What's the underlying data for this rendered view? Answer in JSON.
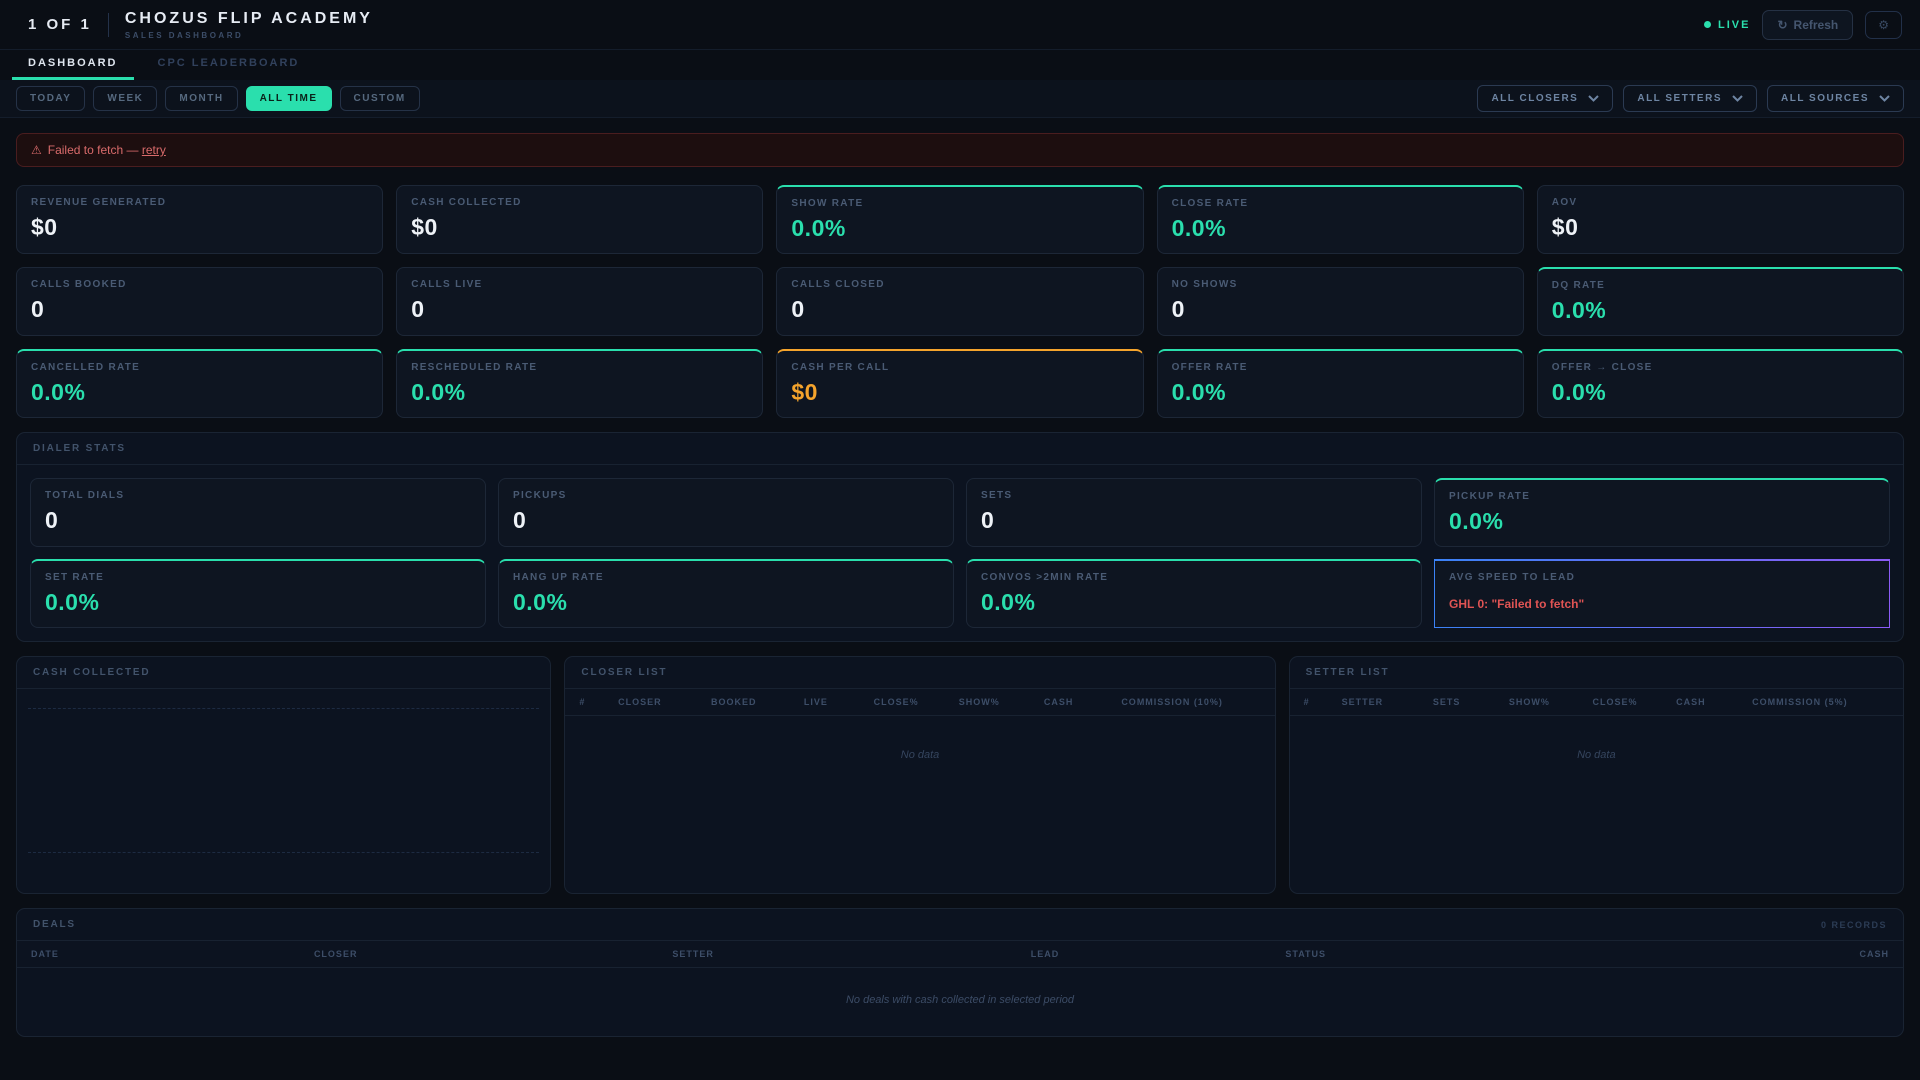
{
  "header": {
    "counter": "1 OF 1",
    "title": "CHOZUS FLIP ACADEMY",
    "subtitle": "SALES DASHBOARD",
    "live_label": "LIVE",
    "refresh_label": "Refresh"
  },
  "icons": {
    "refresh": "↻",
    "gear": "⚙",
    "warning": "⚠",
    "chevron": "▾"
  },
  "tabs": [
    {
      "label": "DASHBOARD",
      "active": true
    },
    {
      "label": "CPC LEADERBOARD",
      "active": false
    }
  ],
  "filters": {
    "ranges": [
      {
        "label": "TODAY",
        "active": false
      },
      {
        "label": "WEEK",
        "active": false
      },
      {
        "label": "MONTH",
        "active": false
      },
      {
        "label": "ALL TIME",
        "active": true
      },
      {
        "label": "CUSTOM",
        "active": false
      }
    ],
    "dropdowns": [
      {
        "label": "ALL CLOSERS"
      },
      {
        "label": "ALL SETTERS"
      },
      {
        "label": "ALL SOURCES"
      }
    ]
  },
  "error_banner": {
    "text": "Failed to fetch —",
    "link": "retry"
  },
  "kpis": [
    {
      "label": "REVENUE GENERATED",
      "value": "$0",
      "accent": "none"
    },
    {
      "label": "CASH COLLECTED",
      "value": "$0",
      "accent": "none"
    },
    {
      "label": "SHOW RATE",
      "value": "0.0%",
      "accent": "teal"
    },
    {
      "label": "CLOSE RATE",
      "value": "0.0%",
      "accent": "teal"
    },
    {
      "label": "AOV",
      "value": "$0",
      "accent": "none"
    },
    {
      "label": "CALLS BOOKED",
      "value": "0",
      "accent": "none"
    },
    {
      "label": "CALLS LIVE",
      "value": "0",
      "accent": "none"
    },
    {
      "label": "CALLS CLOSED",
      "value": "0",
      "accent": "none"
    },
    {
      "label": "NO SHOWS",
      "value": "0",
      "accent": "none"
    },
    {
      "label": "DQ RATE",
      "value": "0.0%",
      "accent": "teal"
    },
    {
      "label": "CANCELLED RATE",
      "value": "0.0%",
      "accent": "teal"
    },
    {
      "label": "RESCHEDULED RATE",
      "value": "0.0%",
      "accent": "teal"
    },
    {
      "label": "CASH PER CALL",
      "value": "$0",
      "accent": "orange"
    },
    {
      "label": "OFFER RATE",
      "value": "0.0%",
      "accent": "teal"
    },
    {
      "label": "OFFER → CLOSE",
      "value": "0.0%",
      "accent": "teal"
    }
  ],
  "dialer": {
    "title": "DIALER STATS",
    "stats": [
      {
        "label": "TOTAL DIALS",
        "value": "0",
        "accent": "none"
      },
      {
        "label": "PICKUPS",
        "value": "0",
        "accent": "none"
      },
      {
        "label": "SETS",
        "value": "0",
        "accent": "none"
      },
      {
        "label": "PICKUP RATE",
        "value": "0.0%",
        "accent": "teal"
      },
      {
        "label": "SET RATE",
        "value": "0.0%",
        "accent": "teal"
      },
      {
        "label": "HANG UP RATE",
        "value": "0.0%",
        "accent": "teal"
      },
      {
        "label": "CONVOS >2MIN RATE",
        "value": "0.0%",
        "accent": "teal"
      },
      {
        "label": "AVG SPEED TO LEAD",
        "error": "GHL 0: \"Failed to fetch\"",
        "accent": "blue"
      }
    ]
  },
  "panels": {
    "cash": {
      "title": "CASH COLLECTED"
    },
    "closer": {
      "title": "CLOSER LIST",
      "columns": [
        "#",
        "CLOSER",
        "BOOKED",
        "LIVE",
        "CLOSE%",
        "SHOW%",
        "CASH",
        "COMMISSION (10%)"
      ],
      "empty": "No data"
    },
    "setter": {
      "title": "SETTER LIST",
      "columns": [
        "#",
        "SETTER",
        "SETS",
        "SHOW%",
        "CLOSE%",
        "CASH",
        "COMMISSION (5%)"
      ],
      "empty": "No data"
    }
  },
  "deals": {
    "title": "DEALS",
    "records": "0 RECORDS",
    "columns": [
      "DATE",
      "CLOSER",
      "SETTER",
      "LEAD",
      "STATUS",
      "CASH"
    ],
    "empty": "No deals with cash collected in selected period"
  },
  "colors": {
    "teal_accent": "#2adfad",
    "orange_accent": "#f5a42c",
    "blue_accent": "#3b82f6",
    "purple_accent": "#8b5cf6",
    "error_red": "#e05454",
    "banner_red": "#d96b6b",
    "live_green": "#2adfad"
  }
}
